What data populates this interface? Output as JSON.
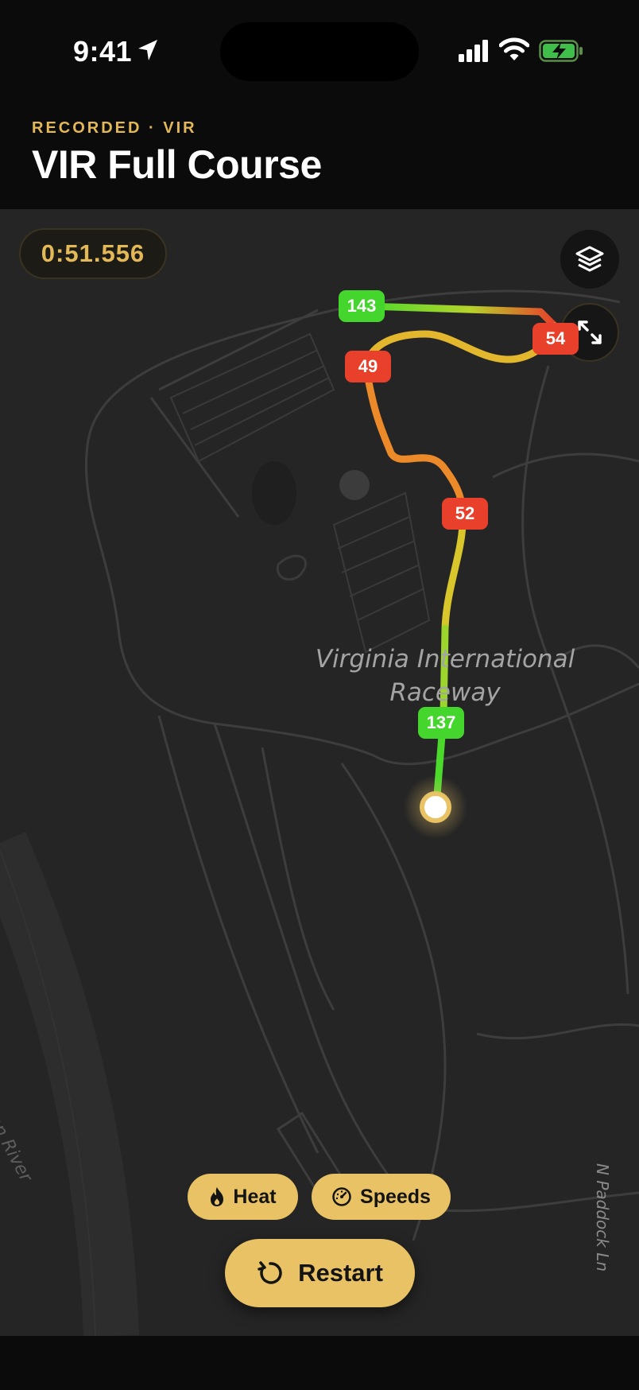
{
  "status_bar": {
    "time": "9:41",
    "icons": [
      "location-arrow-icon",
      "cellular-signal-icon",
      "wifi-icon",
      "battery-charging-icon"
    ]
  },
  "header": {
    "eyebrow": "RECORDED · VIR",
    "title": "VIR Full Course"
  },
  "map": {
    "lap_time": "0:51.556",
    "place_label_line1": "Virginia International",
    "place_label_line2": "Raceway",
    "river_label": "Dan River",
    "road_label": "N Paddock Ln",
    "speed_tags": [
      "143",
      "54",
      "49",
      "52",
      "137"
    ],
    "buttons": [
      "layers-icon",
      "expand-icon"
    ]
  },
  "controls": {
    "heat_label": "Heat",
    "speeds_label": "Speeds",
    "restart_label": "Restart"
  },
  "colors": {
    "accent": "#e8c265",
    "accent_text": "#e3b857",
    "fast": "#44d62c",
    "slow": "#e8402a",
    "map_bg": "#252525"
  }
}
